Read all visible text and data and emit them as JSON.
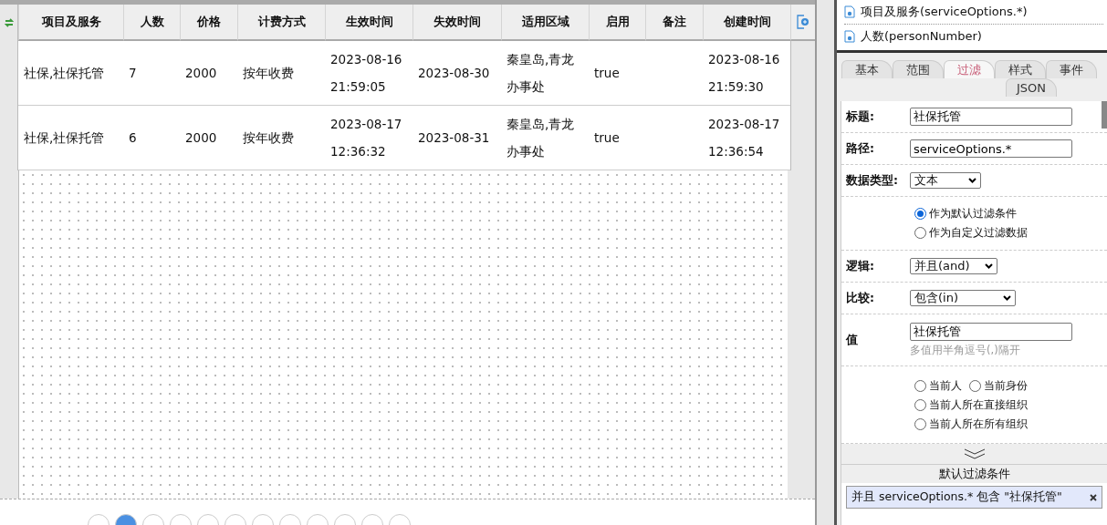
{
  "table": {
    "columns": [
      "项目及服务",
      "人数",
      "价格",
      "计费方式",
      "生效时间",
      "失效时间",
      "适用区域",
      "启用",
      "备注",
      "创建时间"
    ],
    "rows": [
      {
        "cells": [
          "社保,社保托管",
          "7",
          "2000",
          "按年收费",
          "2023-08-16 21:59:05",
          "2023-08-30",
          "秦皇岛,青龙办事处",
          "true",
          "",
          "2023-08-16 21:59:30"
        ]
      },
      {
        "cells": [
          "社保,社保托管",
          "6",
          "2000",
          "按年收费",
          "2023-08-17 12:36:32",
          "2023-08-31",
          "秦皇岛,青龙办事处",
          "true",
          "",
          "2023-08-17 12:36:54"
        ]
      }
    ]
  },
  "pagination": {
    "pages": [
      {
        "selected": false
      },
      {
        "selected": true
      },
      {
        "selected": false
      },
      {
        "selected": false
      },
      {
        "selected": false
      },
      {
        "selected": false
      },
      {
        "selected": false
      },
      {
        "selected": false
      },
      {
        "selected": false
      },
      {
        "selected": false
      },
      {
        "selected": false
      },
      {
        "selected": false
      }
    ]
  },
  "field_list": [
    "项目及服务(serviceOptions.*)",
    "人数(personNumber)"
  ],
  "tabs": [
    {
      "label": "基本",
      "selected": false
    },
    {
      "label": "范围",
      "selected": false
    },
    {
      "label": "过滤",
      "selected": true
    },
    {
      "label": "样式",
      "selected": false
    },
    {
      "label": "事件",
      "selected": false
    },
    {
      "label": "JSON",
      "selected": false
    }
  ],
  "form": {
    "title": {
      "label": "标题:",
      "value": "社保托管"
    },
    "path": {
      "label": "路径:",
      "value": "serviceOptions.*"
    },
    "data_type": {
      "label": "数据类型:",
      "value": "文本"
    },
    "filter_mode": [
      {
        "label": "作为默认过滤条件",
        "selected": true
      },
      {
        "label": "作为自定义过滤数据",
        "selected": false
      }
    ],
    "logic": {
      "label": "逻辑:",
      "value": "并且(and)"
    },
    "compare": {
      "label": "比较:",
      "value": "包含(in)"
    },
    "value": {
      "label": "值",
      "value": "社保托管",
      "hint": "多值用半角逗号(,)隔开"
    },
    "presets": [
      {
        "label": "当前人",
        "selected": false
      },
      {
        "label": "当前身份",
        "selected": false
      },
      {
        "label": "当前人所在直接组织",
        "selected": false
      },
      {
        "label": "当前人所在所有组织",
        "selected": false
      }
    ]
  },
  "default_filters": {
    "title": "默认过滤条件",
    "items": [
      "并且 serviceOptions.* 包含 \"社保托管\""
    ]
  }
}
